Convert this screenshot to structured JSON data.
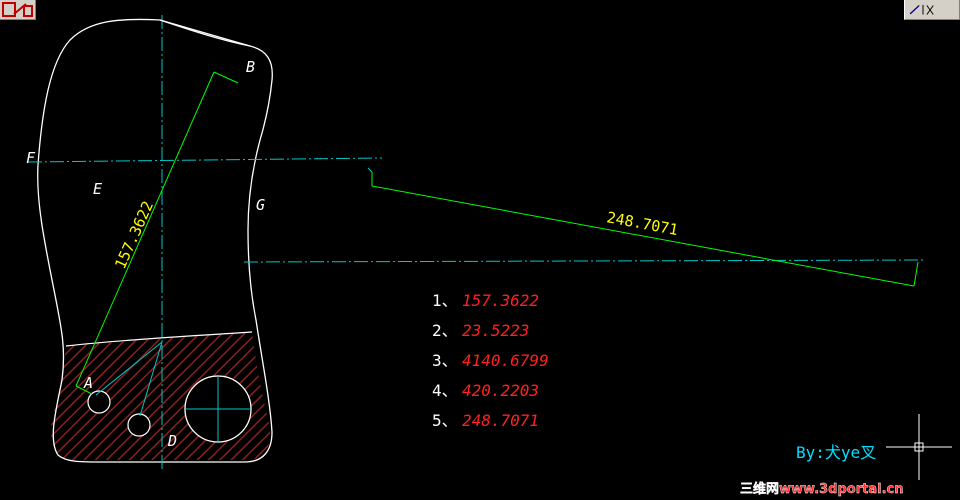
{
  "drawing": {
    "point_labels": [
      "B",
      "F",
      "E",
      "G",
      "A",
      "D"
    ],
    "dimensions": {
      "diagonal": "157.3622",
      "offset": "248.7071"
    },
    "results": [
      {
        "index": "1、",
        "value": "157.3622"
      },
      {
        "index": "2、",
        "value": "23.5223"
      },
      {
        "index": "3、",
        "value": "4140.6799"
      },
      {
        "index": "4、",
        "value": "420.2203"
      },
      {
        "index": "5、",
        "value": "248.7071"
      }
    ],
    "signature": "By:犬ye叉",
    "watermark": "三维网www.3dportal.cn"
  },
  "colors": {
    "background": "#000000",
    "outline": "#ffffff",
    "centerline": "#00c8c8",
    "dimension": "#00ff00",
    "dim_text": "#ffff00",
    "result_value": "#ff2020",
    "result_index": "#ffffff",
    "hatch": "#8b2020",
    "signature": "#00e0ff",
    "watermark": "#ff3030"
  },
  "icons": [
    "toolbar-tool-icon",
    "toolbar-dimension-icon",
    "crosshair-cursor-icon"
  ]
}
